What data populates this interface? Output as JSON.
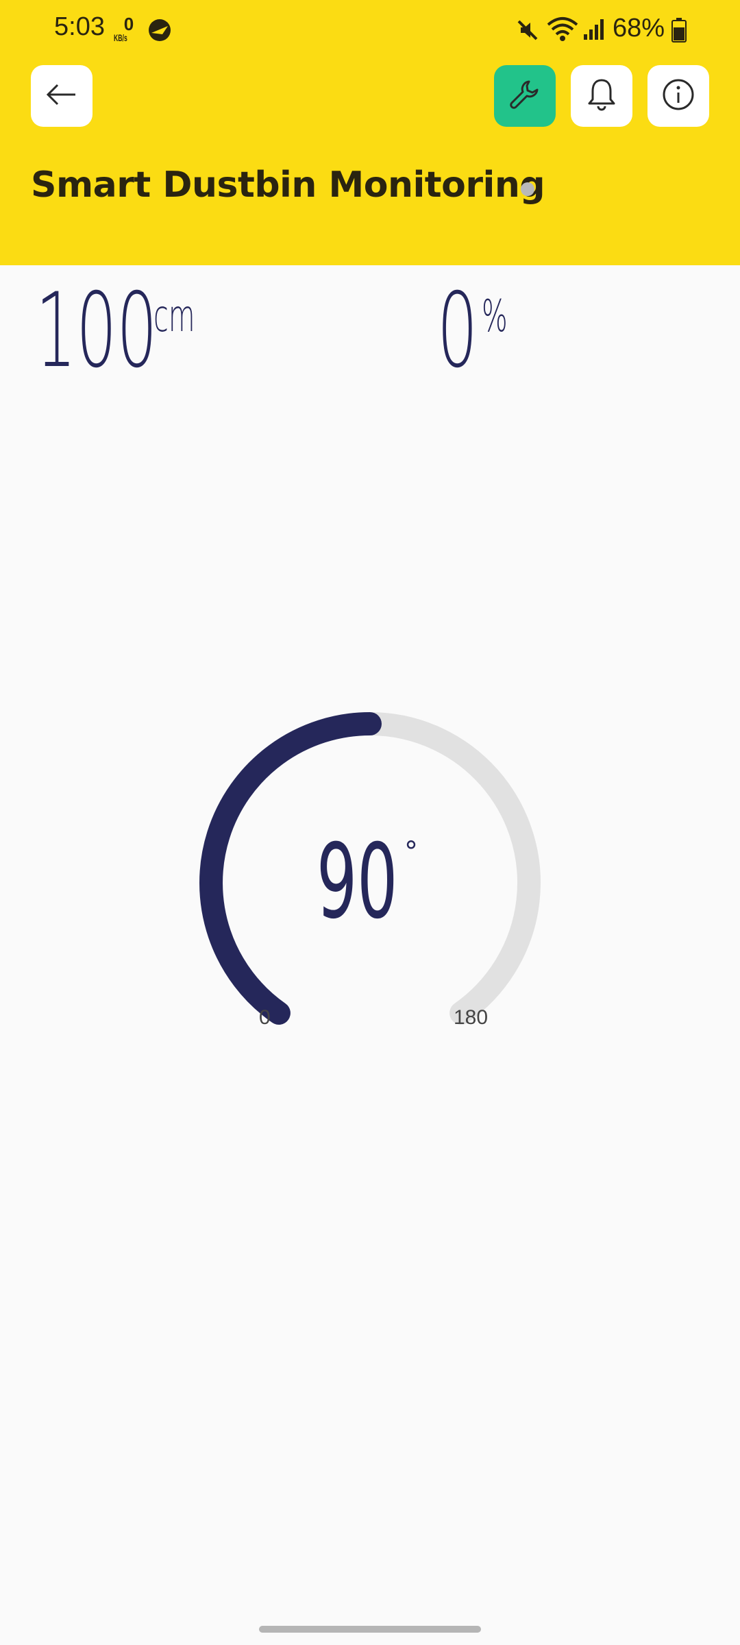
{
  "status_bar": {
    "time": "5:03",
    "net_speed_value": "0",
    "net_speed_unit": "KB/s",
    "battery": "68%",
    "icons": [
      "app-notification-icon",
      "mute-icon",
      "wifi-icon",
      "signal-icon",
      "battery-icon"
    ]
  },
  "header": {
    "title": "Smart Dustbin Monitoring",
    "background_color": "#fbdc13",
    "back_icon": "arrow-left-icon",
    "actions": [
      {
        "name": "wrench-icon",
        "color": "#22c38a"
      },
      {
        "name": "bell-icon"
      },
      {
        "name": "info-icon"
      }
    ],
    "status_dot_color": "#b9b9b9"
  },
  "distance": {
    "value": "100",
    "unit": "cm"
  },
  "fill_level": {
    "value": "0",
    "unit": "%"
  },
  "gauge": {
    "value": "90",
    "unit": "°",
    "min": "0",
    "max": "180",
    "progress_fraction": 0.5,
    "active_color": "#25275a",
    "track_color": "#e1e1e1"
  }
}
